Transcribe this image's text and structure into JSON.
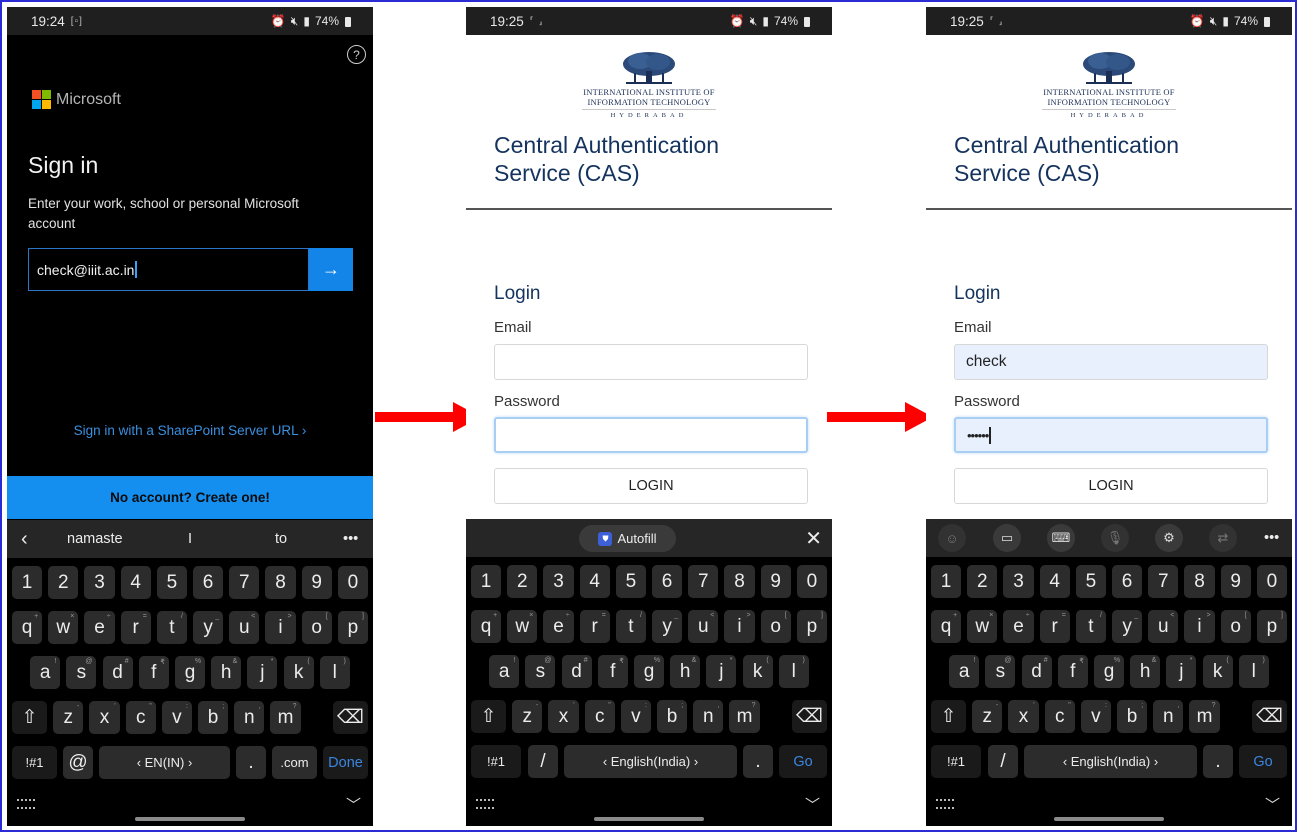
{
  "colors": {
    "frame_border": "#2b2bd6",
    "arrow": "#ff0000",
    "ms_blue": "#148ff0",
    "cas_navy": "#14335e",
    "autofill_bg": "#e8f0fe"
  },
  "phone1": {
    "status": {
      "time": "19:24",
      "battery": "74%"
    },
    "help_icon": "?",
    "brand": "Microsoft",
    "title": "Sign in",
    "description": "Enter your work, school or personal Microsoft account",
    "email_value": "check@iiit.ac.in",
    "next_icon": "→",
    "sharepoint_link": "Sign in with a SharePoint Server URL  ›",
    "create_account": "No account? Create one!",
    "suggestions": [
      "namaste",
      "I",
      "to"
    ],
    "bottom_row": {
      "sym": "!#1",
      "at": "@",
      "space": "‹   EN(IN)   ›",
      "dot": ".",
      "com": ".com",
      "action": "Done"
    }
  },
  "cas": {
    "logo_line1": "INTERNATIONAL INSTITUTE OF",
    "logo_line2": "INFORMATION TECHNOLOGY",
    "logo_line3": "HYDERABAD",
    "title_line1": "Central Authentication",
    "title_line2": "Service (CAS)",
    "login_heading": "Login",
    "email_label": "Email",
    "password_label": "Password",
    "login_button": "LOGIN"
  },
  "phone2": {
    "status": {
      "time": "19:25",
      "battery": "74%"
    },
    "email_value": "",
    "password_value": "",
    "autofill_label": "Autofill",
    "bottom_row": {
      "sym": "!#1",
      "slash": "/",
      "space": "‹      English(India)      ›",
      "dot": ".",
      "action": "Go"
    }
  },
  "phone3": {
    "status": {
      "time": "19:25",
      "battery": "74%"
    },
    "email_value": "check",
    "password_value": "••••••",
    "bottom_row": {
      "sym": "!#1",
      "slash": "/",
      "space": "‹      English(India)      ›",
      "dot": ".",
      "action": "Go"
    }
  },
  "keyboard": {
    "numbers": [
      "1",
      "2",
      "3",
      "4",
      "5",
      "6",
      "7",
      "8",
      "9",
      "0"
    ],
    "row1": [
      {
        "k": "q",
        "s": "+"
      },
      {
        "k": "w",
        "s": "×"
      },
      {
        "k": "e",
        "s": "÷"
      },
      {
        "k": "r",
        "s": "="
      },
      {
        "k": "t",
        "s": "/"
      },
      {
        "k": "y",
        "s": "_"
      },
      {
        "k": "u",
        "s": "<"
      },
      {
        "k": "i",
        "s": ">"
      },
      {
        "k": "o",
        "s": "["
      },
      {
        "k": "p",
        "s": "]"
      }
    ],
    "row2": [
      {
        "k": "a",
        "s": "!"
      },
      {
        "k": "s",
        "s": "@"
      },
      {
        "k": "d",
        "s": "#"
      },
      {
        "k": "f",
        "s": "₹"
      },
      {
        "k": "g",
        "s": "%"
      },
      {
        "k": "h",
        "s": "&"
      },
      {
        "k": "j",
        "s": "*"
      },
      {
        "k": "k",
        "s": "("
      },
      {
        "k": "l",
        "s": ")"
      }
    ],
    "row3": [
      {
        "k": "z",
        "s": "-"
      },
      {
        "k": "x",
        "s": "'"
      },
      {
        "k": "c",
        "s": "\""
      },
      {
        "k": "v",
        "s": ":"
      },
      {
        "k": "b",
        "s": ";"
      },
      {
        "k": "n",
        "s": ","
      },
      {
        "k": "m",
        "s": "?"
      }
    ],
    "shift_icon": "⇧",
    "backspace_icon": "⌫"
  }
}
